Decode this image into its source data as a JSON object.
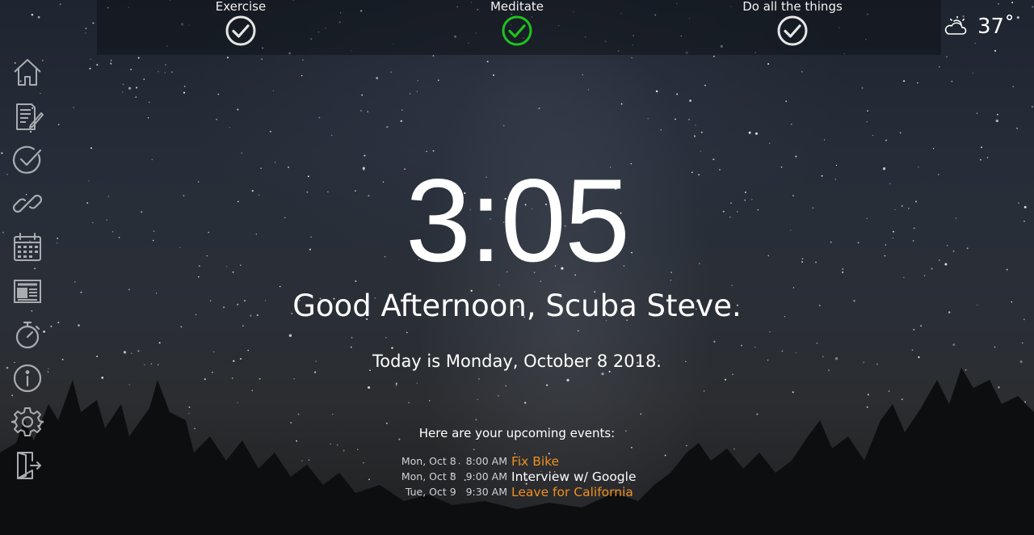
{
  "habits": [
    {
      "label": "Exercise",
      "done": false
    },
    {
      "label": "Meditate",
      "done": true
    },
    {
      "label": "Do all the things",
      "done": false
    }
  ],
  "colors": {
    "done_check": "#1fc21f",
    "undone_check": "#e6e6e6",
    "accent_event": "#f0901e",
    "normal_event": "#ffffff",
    "icon": "#a9acb0"
  },
  "weather": {
    "icon": "partly-cloudy-icon",
    "temp": "37˚"
  },
  "sidebar": {
    "items": [
      {
        "name": "home",
        "icon": "home-icon"
      },
      {
        "name": "notes",
        "icon": "notes-icon"
      },
      {
        "name": "habits",
        "icon": "check-circle-icon"
      },
      {
        "name": "links",
        "icon": "link-icon"
      },
      {
        "name": "calendar",
        "icon": "calendar-icon"
      },
      {
        "name": "news",
        "icon": "newspaper-icon"
      },
      {
        "name": "timer",
        "icon": "stopwatch-icon"
      },
      {
        "name": "info",
        "icon": "info-icon"
      },
      {
        "name": "settings",
        "icon": "gear-icon"
      },
      {
        "name": "logout",
        "icon": "exit-door-icon"
      }
    ]
  },
  "main": {
    "clock": "3:05",
    "greeting": "Good Afternoon, Scuba Steve.",
    "date_line": "Today is Monday, October 8 2018."
  },
  "events": {
    "heading": "Here are your upcoming events:",
    "items": [
      {
        "date": "Mon, Oct 8",
        "time": "8:00 AM",
        "title": "Fix Bike",
        "highlight": true
      },
      {
        "date": "Mon, Oct 8",
        "time": "9:00 AM",
        "title": "Interview w/ Google",
        "highlight": false
      },
      {
        "date": "Tue, Oct 9",
        "time": "9:30 AM",
        "title": "Leave for California",
        "highlight": true
      }
    ]
  }
}
